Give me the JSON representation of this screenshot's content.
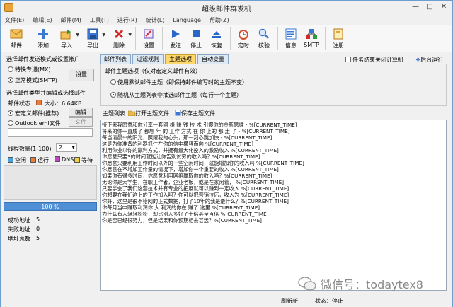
{
  "window": {
    "title": "超级邮件群发机",
    "min": "—",
    "max": "□",
    "close": "✕"
  },
  "menu": [
    "文件(E)",
    "编辑(E)",
    "邮件(M)",
    "工具(T)",
    "进行(R)",
    "统计(L)",
    "Language",
    "帮助(Z)"
  ],
  "toolbar": [
    {
      "label": "邮件",
      "icon": "mail-icon",
      "color": "#e8a33a"
    },
    {
      "label": "添加",
      "icon": "add-icon",
      "color": "#3a78d4"
    },
    {
      "label": "导入",
      "icon": "import-icon",
      "color": "#2a9a3a",
      "dropdown": "▼"
    },
    {
      "label": "导出",
      "icon": "export-icon",
      "color": "#3a78d4",
      "dropdown": "▼"
    },
    {
      "label": "删除",
      "icon": "delete-icon",
      "color": "#d42a2a",
      "dropdown": "▼"
    },
    {
      "label": "设置",
      "icon": "settings-icon",
      "color": "#6b4fb8"
    },
    {
      "label": "发送",
      "icon": "send-icon",
      "color": "#2a66c8"
    },
    {
      "label": "停止",
      "icon": "stop-icon",
      "color": "#2a66c8"
    },
    {
      "label": "恢复",
      "icon": "resume-icon",
      "color": "#2a66c8"
    },
    {
      "label": "定时",
      "icon": "timer-icon",
      "color": "#d94a2a"
    },
    {
      "label": "校验",
      "icon": "verify-icon",
      "color": "#3a78d4"
    },
    {
      "label": "信息",
      "icon": "info-icon",
      "color": "#3a78d4"
    },
    {
      "label": "SMTP",
      "icon": "smtp-icon",
      "color": "#d42a2a"
    },
    {
      "label": "注册",
      "icon": "register-icon",
      "color": "#e8a33a"
    }
  ],
  "left": {
    "mode_title": "选择邮件发送模式或设置帐户",
    "mode_fast": "特快专递(MX)",
    "mode_normal": "正常模式(SMTP)",
    "settings_btn": "设置",
    "type_title": "选择邮件类型并编辑或选择邮件",
    "status_label": "邮件状态",
    "size_label": "大小：6.64KB",
    "type_macro": "宏定义邮件(推荐)",
    "edit_btn": "编辑",
    "type_outlook": "Outlook eml文件",
    "file_btn": "文件",
    "threads_label": "线程数量(1-100)",
    "threads_value": "2",
    "legend": [
      {
        "label": "空闲",
        "color": "#4aa3df"
      },
      {
        "label": "运行",
        "color": "#e87c3a"
      },
      {
        "label": "DNS",
        "color": "#c63fc6"
      },
      {
        "label": "等待",
        "color": "#f4d23a"
      }
    ],
    "progress": "100 %",
    "stats": [
      {
        "label": "成功地址",
        "value": "5"
      },
      {
        "label": "失败地址",
        "value": "0"
      },
      {
        "label": "地址总数",
        "value": "5"
      }
    ]
  },
  "tabs": [
    "邮件列表",
    "过滤规则",
    "主题选项",
    "自动变量"
  ],
  "active_tab": 2,
  "close_after": "任务结束关闭计算机",
  "bg_run": "后台运行",
  "panel": {
    "title": "邮件主题选项（仅对宏定义邮件有效）",
    "opt1": "使用默认邮件主题（即保持邮件编写时的主题不变）",
    "opt2": "随机从主题列表中抽选邮件主题（每行一个主题）"
  },
  "subbar": {
    "list": "主题列表",
    "open": "打开主题文件",
    "save": "保存主题文件"
  },
  "subjects": [
    "接下来我愿意和你分享一套网 络 赚 钱 技 术 引爆你的金新思维 - %[CURRENT_TIME]",
    "将来的你一直成了 都想 年 的 工作 方式 在 你 上的 都 走 了 - %[CURRENT_TIME]",
    "每当清晨**的阳光，照耀我的心头，那一刻心跳加快 - %[CURRENT_TIME]",
    "这是为你准备的利器抓住在你的信中横竖而向 %[CURRENT_TIME]",
    "利用你业以你的赢利方式，并拥有最大化投入的激励收入 %[CURRENT_TIME]",
    "你愿意只要3的时间就能让你告别贫穷的收入吗？%[CURRENT_TIME]",
    "你愿意只要利用工作时间以外的一些空闲时间，就能增加你的收入吗 %[CURRENT_TIME]",
    "你愿意在不增加工作量的情况下，增加你一个重要的收入 %[CURRENT_TIME]",
    "如果你有很多时间，你愿意利用网络赢取你的收入吗？%[CURRENT_TIME]",
    "无论你是大学生，在职工作者，企业老板，或是在家闲着， %[CURRENT_TIME]",
    "只要学会了我们这套技术并有专业的拓展就可以赚到一定收入 %[CURRENT_TIME]",
    "你想要在我们这上的工作加入吗？你可以把营销技巧，收入为 %[CURRENT_TIME]",
    "你好，这里是很不错网的正式数据，打了10年的我是最什么？%[CURRENT_TIME]",
    "你每月当中赚取利润你 大 利润的你在 赚了 这里 %[CURRENT_TIME]",
    "为什么有人轻轻松松，却比别人多好了十倍甚至百倍 %[CURRENT_TIME]",
    "你是否已经很努力，但是结果和你预期相去甚远？%[CURRENT_TIME]"
  ],
  "status": {
    "refresh": "刷新新",
    "state": "状态：停止"
  },
  "watermark": "微信号：todaytex8"
}
